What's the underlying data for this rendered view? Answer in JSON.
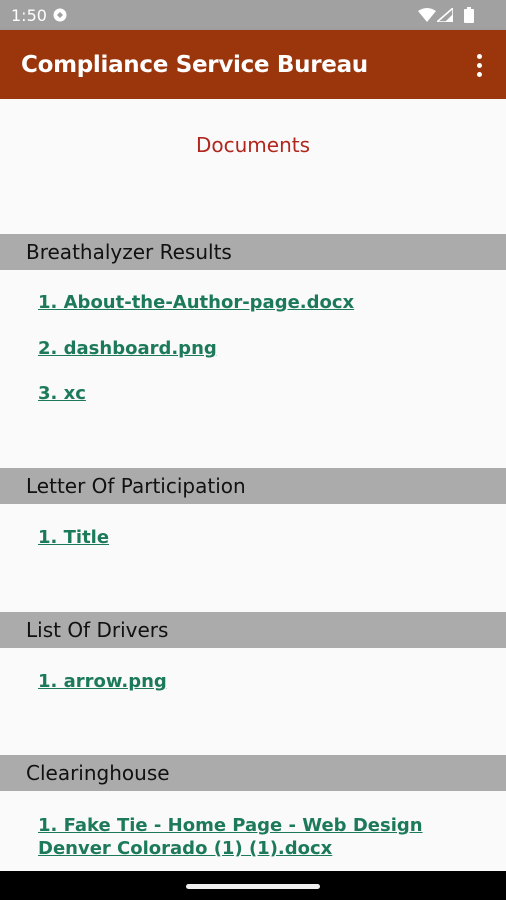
{
  "status": {
    "time": "1:50"
  },
  "appbar": {
    "title": "Compliance Service Bureau"
  },
  "page": {
    "title": "Documents"
  },
  "sections": [
    {
      "header": "Breathalyzer Results",
      "items": [
        "1. About-the-Author-page.docx",
        "2. dashboard.png",
        "3. xc"
      ]
    },
    {
      "header": "Letter Of Participation",
      "items": [
        "1. Title"
      ]
    },
    {
      "header": "List Of Drivers",
      "items": [
        "1. arrow.png"
      ]
    },
    {
      "header": "Clearinghouse",
      "items": [
        "1. Fake Tie - Home Page - Web Design Denver Colorado (1) (1).docx"
      ]
    }
  ],
  "colors": {
    "appbar": "#9b360c",
    "page_title": "#b1261d",
    "link": "#1c7a5a",
    "section_header_bg": "#ababab"
  }
}
